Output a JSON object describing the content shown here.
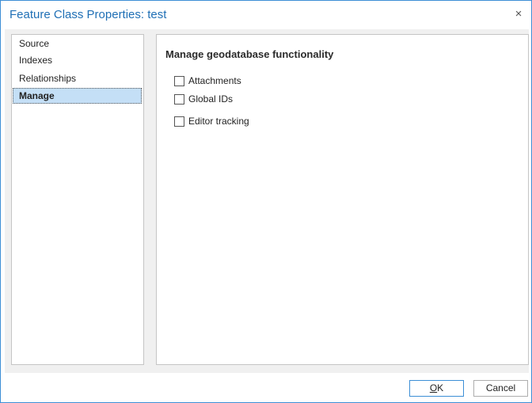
{
  "window": {
    "title": "Feature Class Properties: test",
    "close_glyph": "×"
  },
  "nav": {
    "items": [
      {
        "label": "Source",
        "selected": false
      },
      {
        "label": "Indexes",
        "selected": false
      },
      {
        "label": "Relationships",
        "selected": false
      },
      {
        "label": "Manage",
        "selected": true
      }
    ]
  },
  "main": {
    "heading": "Manage geodatabase functionality",
    "options": [
      {
        "label": "Attachments",
        "checked": false
      },
      {
        "label": "Global IDs",
        "checked": false
      },
      {
        "label": "Editor tracking",
        "checked": false
      }
    ]
  },
  "buttons": {
    "ok_access_key": "O",
    "ok_rest": "K",
    "cancel_label": "Cancel"
  },
  "colors": {
    "accent": "#1f6fb5",
    "border_accent": "#3d8fd6",
    "selection": "#c4dff6",
    "panel_background": "#f0f0f0"
  }
}
